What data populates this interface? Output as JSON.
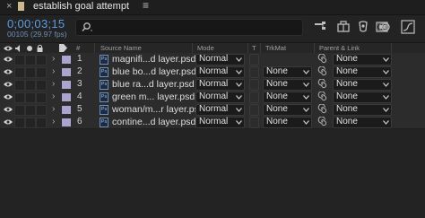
{
  "titlebar": {
    "close_glyph": "×",
    "title": "establish goal attempt",
    "menu_glyph": "≡"
  },
  "toolbar": {
    "timecode": "0;00;03;15",
    "frame_info": "00105 (29.97 fps)",
    "search_value": "",
    "icons": [
      "comp-mini-flowchart-icon",
      "draft-3d-icon",
      "shy-layers-icon",
      "frame-blending-icon",
      "motion-blur-icon",
      "graph-editor-icon"
    ]
  },
  "columns": {
    "hash": "#",
    "source_name": "Source Name",
    "mode": "Mode",
    "track_t": "T",
    "trkmat": "TrkMat",
    "parent_link": "Parent & Link"
  },
  "layers": [
    {
      "num": "1",
      "name": "magnifi...d layer.psd",
      "mode": "Normal",
      "trkmat": "",
      "parent": "None"
    },
    {
      "num": "2",
      "name": "blue bo...d layer.psd",
      "mode": "Normal",
      "trkmat": "None",
      "parent": "None"
    },
    {
      "num": "3",
      "name": "blue ra...d layer.psd",
      "mode": "Normal",
      "trkmat": "None",
      "parent": "None"
    },
    {
      "num": "4",
      "name": "green m... layer.psd",
      "mode": "Normal",
      "trkmat": "None",
      "parent": "None"
    },
    {
      "num": "5",
      "name": "woman/m...r layer.psd",
      "mode": "Normal",
      "trkmat": "None",
      "parent": "None"
    },
    {
      "num": "6",
      "name": "contine...d layer.psd",
      "mode": "Normal",
      "trkmat": "None",
      "parent": "None"
    }
  ],
  "colors": {
    "timecode": "#5d9ce0",
    "label": "#a9a5ce",
    "panel": "#232323",
    "row": "#2c2c2c"
  }
}
